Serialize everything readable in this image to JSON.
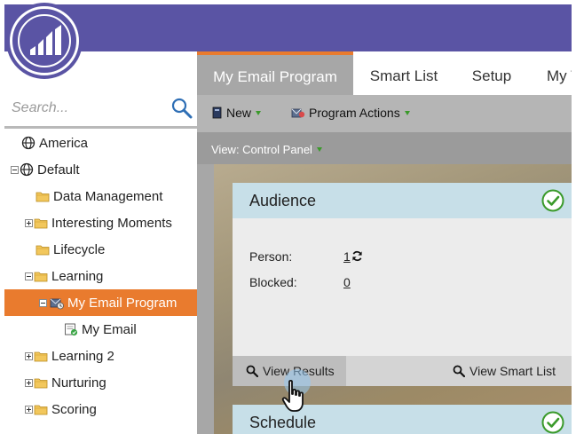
{
  "colors": {
    "header_purple": "#5a54a4",
    "accent_orange": "#e97b2e",
    "card_header_blue": "#c7dfe8",
    "check_green": "#3a9a2a"
  },
  "search": {
    "placeholder": "Search..."
  },
  "tree": [
    {
      "label": "America",
      "icon": "globe-icon",
      "expander": "none",
      "indent": 0
    },
    {
      "label": "Default",
      "icon": "globe-icon",
      "expander": "minus",
      "indent": 0
    },
    {
      "label": "Data Management",
      "icon": "folder-icon",
      "expander": "none",
      "indent": 1
    },
    {
      "label": "Interesting Moments",
      "icon": "folder-icon",
      "expander": "plus",
      "indent": 1
    },
    {
      "label": "Lifecycle",
      "icon": "folder-icon",
      "expander": "none",
      "indent": 1
    },
    {
      "label": "Learning",
      "icon": "folder-icon",
      "expander": "minus",
      "indent": 1
    },
    {
      "label": "My Email Program",
      "icon": "email-program-icon",
      "expander": "minus",
      "indent": 2,
      "active": true
    },
    {
      "label": "My Email",
      "icon": "email-icon",
      "expander": "none",
      "indent": 3
    },
    {
      "label": "Learning 2",
      "icon": "folder-icon",
      "expander": "plus",
      "indent": 1
    },
    {
      "label": "Nurturing",
      "icon": "folder-icon",
      "expander": "plus",
      "indent": 1
    },
    {
      "label": "Scoring",
      "icon": "folder-icon",
      "expander": "plus",
      "indent": 1
    }
  ],
  "tabs": [
    {
      "label": "My Email Program",
      "active": true
    },
    {
      "label": "Smart List",
      "active": false
    },
    {
      "label": "Setup",
      "active": false
    },
    {
      "label": "My T",
      "active": false
    }
  ],
  "toolbar": {
    "new_label": "New",
    "program_actions_label": "Program Actions"
  },
  "view": {
    "label": "View: Control Panel"
  },
  "audience": {
    "title": "Audience",
    "rows": [
      {
        "label": "Person:",
        "value": "1"
      },
      {
        "label": "Blocked:",
        "value": "0"
      }
    ],
    "view_results": "View Results",
    "view_smart_list": "View Smart List"
  },
  "schedule": {
    "title": "Schedule"
  }
}
